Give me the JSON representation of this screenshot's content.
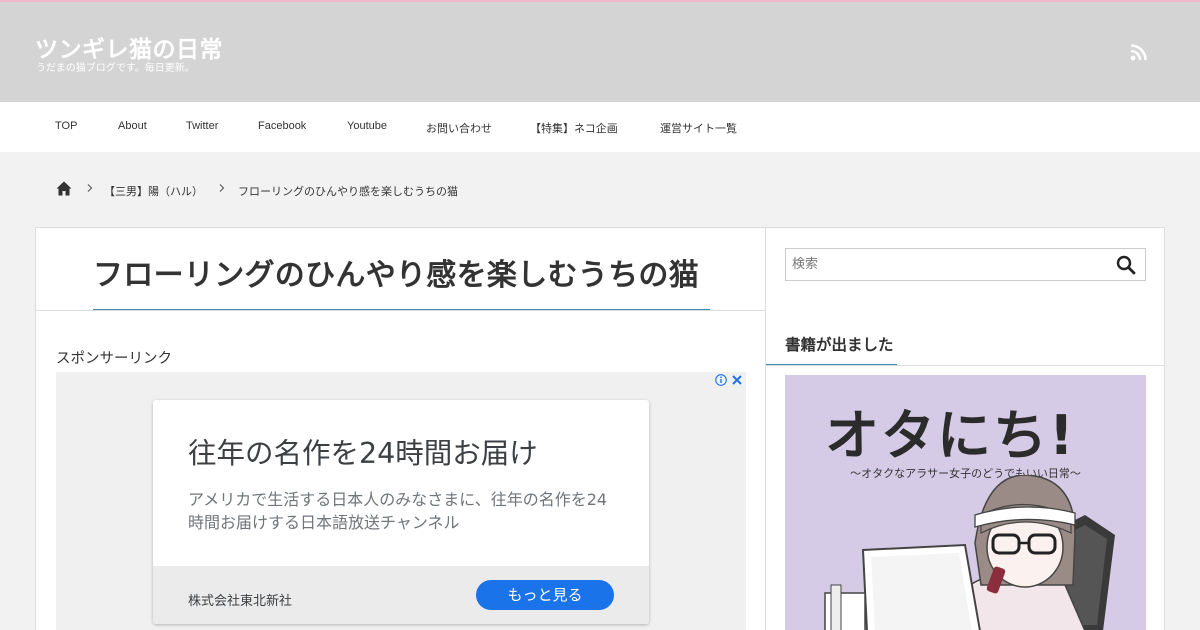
{
  "header": {
    "site_title": "ツンギレ猫の日常",
    "site_description": "うだまの猫ブログです。毎日更新。",
    "rss_icon": "rss-icon"
  },
  "nav": {
    "items": [
      "TOP",
      "About",
      "Twitter",
      "Facebook",
      "Youtube",
      "お問い合わせ",
      "【特集】ネコ企画",
      "運営サイト一覧"
    ]
  },
  "breadcrumb": {
    "home_icon": "home-icon",
    "items": [
      "【三男】陽（ハル）",
      "フローリングのひんやり感を楽しむうちの猫"
    ]
  },
  "article": {
    "title": "フローリングのひんやり感を楽しむうちの猫",
    "sponsor_label": "スポンサーリンク"
  },
  "ad": {
    "headline": "往年の名作を24時間お届け",
    "body": "アメリカで生活する日本人のみなさまに、往年の名作を24時間お届けする日本語放送チャンネル",
    "advertiser": "株式会社東北新社",
    "cta": "もっと見る"
  },
  "sidebar": {
    "search_placeholder": "検索",
    "widget_title": "書籍が出ました",
    "book_title": "オタにち!",
    "book_subtitle": "〜オタクなアラサー女子のどうでもいい日常〜"
  },
  "colors": {
    "header_bg": "#d4d4d4",
    "accent_line": "#3b8fa8",
    "top_stripe": "#f4b6cc",
    "ad_button": "#1a73e8",
    "book_bg": "#d6cbe6"
  }
}
